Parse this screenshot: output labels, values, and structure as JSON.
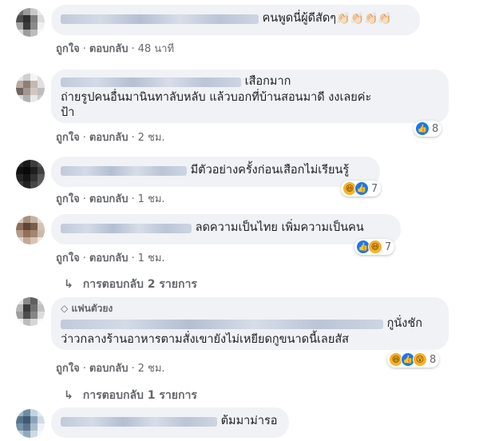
{
  "actions": {
    "like": "ถูกใจ",
    "reply": "ตอบกลับ",
    "dot": "·"
  },
  "comments": [
    {
      "text": "คนพูดนี่ผู้ดีสัดๆ",
      "emoji": "👏🏻👏🏻👏🏻👏🏻",
      "time": "48 นาที"
    },
    {
      "text_line1": "เสือกมาก",
      "text_line2": "ถ่ายรูปคนอื่นมานินทาลับหลับ แล้วบอกที่บ้านสอนมาดี งงเลยค่ะ",
      "text_line3": "ป้า",
      "time": "2 ชม.",
      "reaction_icons": [
        "like"
      ],
      "reaction_count": "8"
    },
    {
      "text": "มีตัวอย่างครั้งก่อนเสือกไม่เรียนรู้",
      "time": "1 ชม.",
      "reaction_icons": [
        "haha",
        "like"
      ],
      "reaction_count": "7"
    },
    {
      "text": "ลดความเป็นไทย เพิ่มความเป็นคน",
      "time": "1 ชม.",
      "reaction_icons": [
        "like",
        "haha"
      ],
      "reaction_count": "7",
      "replies": "การตอบกลับ 2 รายการ"
    },
    {
      "badge": "แฟนตัวยง",
      "text_line1": "กูนั่งชัก",
      "text_line2": "ว่าวกลางร้านอาหารตามสั่งเขายังไม่เหยียดกูขนาดนี้เลยสัส",
      "time": "2 ชม.",
      "reaction_icons": [
        "haha",
        "like",
        "wow"
      ],
      "reaction_count": "8",
      "replies": "การตอบกลับ 1 รายการ"
    },
    {
      "text": "ต้มมาม่ารอ"
    }
  ],
  "colors": {
    "bubble": "#f0f2f5",
    "meta": "#65676b",
    "like_blue": "#1877f2"
  }
}
